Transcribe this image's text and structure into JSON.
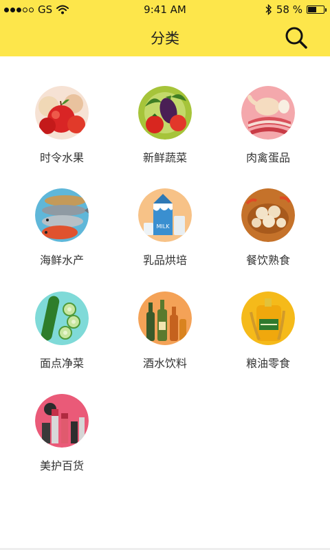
{
  "status_bar": {
    "carrier": "GS",
    "time": "9:41 AM",
    "battery_text": "58 %",
    "battery_level": 0.58,
    "signal_bars_filled": 3,
    "signal_bars_total": 5
  },
  "header": {
    "title": "分类",
    "background_color": "#fde64b"
  },
  "categories": [
    {
      "label": "时令水果",
      "icon": "fruit-icon"
    },
    {
      "label": "新鲜蔬菜",
      "icon": "vegetable-icon"
    },
    {
      "label": "肉禽蛋品",
      "icon": "meat-icon"
    },
    {
      "label": "海鲜水产",
      "icon": "seafood-icon"
    },
    {
      "label": "乳品烘培",
      "icon": "dairy-icon"
    },
    {
      "label": "餐饮熟食",
      "icon": "deli-icon"
    },
    {
      "label": "面点净菜",
      "icon": "cucumber-icon"
    },
    {
      "label": "酒水饮料",
      "icon": "drinks-icon"
    },
    {
      "label": "粮油零食",
      "icon": "oil-icon"
    },
    {
      "label": "美护百货",
      "icon": "cosmetics-icon"
    }
  ]
}
